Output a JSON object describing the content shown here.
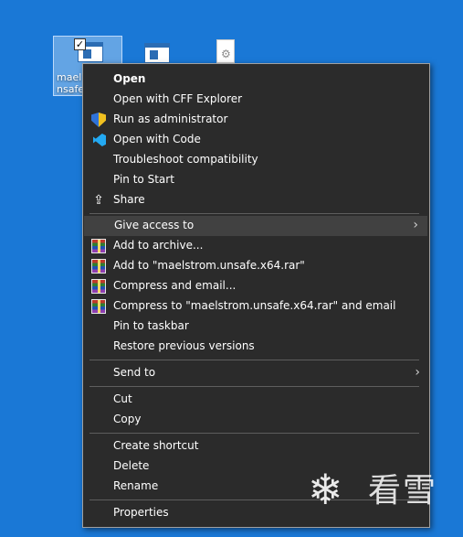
{
  "desktop": {
    "background_color": "#1a78d6",
    "selected_icon_label_line1": "mael",
    "selected_icon_label_line2": "nsafe"
  },
  "context_menu": {
    "items": [
      {
        "label": "Open",
        "bold": true
      },
      {
        "label": "Open with CFF Explorer"
      },
      {
        "label": "Run as administrator",
        "icon": "shield-icon"
      },
      {
        "label": "Open with Code",
        "icon": "vscode-icon"
      },
      {
        "label": "Troubleshoot compatibility"
      },
      {
        "label": "Pin to Start"
      },
      {
        "label": "Share",
        "icon": "share-icon"
      },
      {
        "label": "Give access to",
        "submenu": true,
        "highlighted": true
      },
      {
        "label": "Add to archive...",
        "icon": "winrar-icon"
      },
      {
        "label": "Add to \"maelstrom.unsafe.x64.rar\"",
        "icon": "winrar-icon"
      },
      {
        "label": "Compress and email...",
        "icon": "winrar-icon"
      },
      {
        "label": "Compress to \"maelstrom.unsafe.x64.rar\" and email",
        "icon": "winrar-icon"
      },
      {
        "label": "Pin to taskbar"
      },
      {
        "label": "Restore previous versions"
      },
      {
        "label": "Send to",
        "submenu": true
      },
      {
        "label": "Cut"
      },
      {
        "label": "Copy"
      },
      {
        "label": "Create shortcut"
      },
      {
        "label": "Delete"
      },
      {
        "label": "Rename"
      },
      {
        "label": "Properties"
      }
    ],
    "chevron": "›",
    "colors": {
      "background": "#2b2b2b",
      "highlight": "#414141",
      "text": "#ffffff"
    }
  },
  "watermark": {
    "text": "看雪",
    "flake": "❄"
  }
}
